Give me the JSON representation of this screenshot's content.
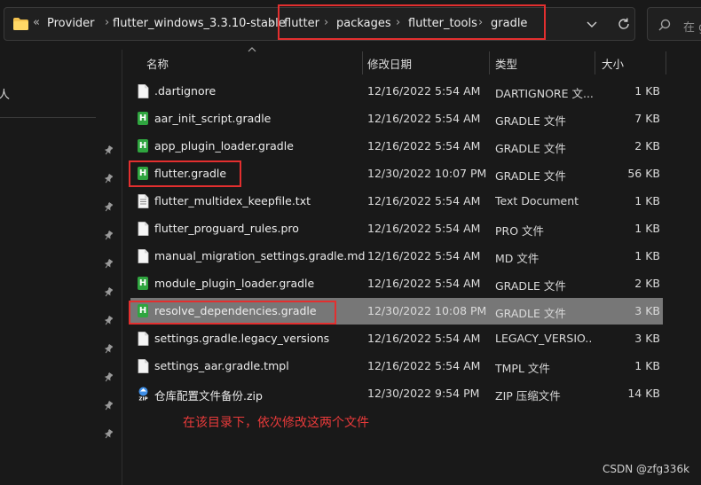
{
  "address": {
    "overflow": "«",
    "crumbs": [
      "Provider",
      "flutter_windows_3.3.10-stable",
      "flutter",
      "packages",
      "flutter_tools",
      "gradle"
    ]
  },
  "search": {
    "placeholder": "在 g"
  },
  "nav": {
    "partial_label": "人"
  },
  "columns": {
    "name": "名称",
    "date": "修改日期",
    "type": "类型",
    "size": "大小"
  },
  "files": [
    {
      "name": ".dartignore",
      "date": "12/16/2022 5:54 AM",
      "type": "DARTIGNORE 文...",
      "size": "1 KB",
      "icon": "document-icon"
    },
    {
      "name": "aar_init_script.gradle",
      "date": "12/16/2022 5:54 AM",
      "type": "GRADLE 文件",
      "size": "7 KB",
      "icon": "gradle-icon"
    },
    {
      "name": "app_plugin_loader.gradle",
      "date": "12/16/2022 5:54 AM",
      "type": "GRADLE 文件",
      "size": "2 KB",
      "icon": "gradle-icon"
    },
    {
      "name": "flutter.gradle",
      "date": "12/30/2022 10:07 PM",
      "type": "GRADLE 文件",
      "size": "56 KB",
      "icon": "gradle-icon"
    },
    {
      "name": "flutter_multidex_keepfile.txt",
      "date": "12/16/2022 5:54 AM",
      "type": "Text Document",
      "size": "1 KB",
      "icon": "text-document-icon"
    },
    {
      "name": "flutter_proguard_rules.pro",
      "date": "12/16/2022 5:54 AM",
      "type": "PRO 文件",
      "size": "1 KB",
      "icon": "document-icon"
    },
    {
      "name": "manual_migration_settings.gradle.md",
      "date": "12/16/2022 5:54 AM",
      "type": "MD 文件",
      "size": "1 KB",
      "icon": "document-icon"
    },
    {
      "name": "module_plugin_loader.gradle",
      "date": "12/16/2022 5:54 AM",
      "type": "GRADLE 文件",
      "size": "2 KB",
      "icon": "gradle-icon"
    },
    {
      "name": "resolve_dependencies.gradle",
      "date": "12/30/2022 10:08 PM",
      "type": "GRADLE 文件",
      "size": "3 KB",
      "icon": "gradle-icon",
      "selected": true
    },
    {
      "name": "settings.gradle.legacy_versions",
      "date": "12/16/2022 5:54 AM",
      "type": "LEGACY_VERSIO...",
      "size": "3 KB",
      "icon": "document-icon"
    },
    {
      "name": "settings_aar.gradle.tmpl",
      "date": "12/16/2022 5:54 AM",
      "type": "TMPL 文件",
      "size": "1 KB",
      "icon": "document-icon"
    },
    {
      "name": "仓库配置文件备份.zip",
      "date": "12/30/2022 9:54 PM",
      "type": "ZIP 压缩文件",
      "size": "14 KB",
      "icon": "zip-archive-icon"
    }
  ],
  "annotation": "在该目录下，依次修改这两个文件",
  "watermark": "CSDN @zfg336k",
  "colors": {
    "selection": "#777777",
    "highlight_box": "#e32f2f",
    "gradle_green": "#2fa53f",
    "annotation_text": "#e83a3a"
  }
}
